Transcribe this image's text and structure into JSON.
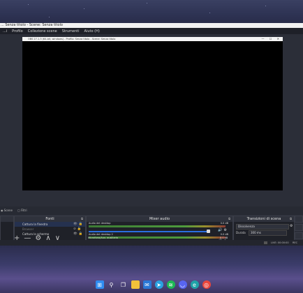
{
  "window": {
    "title": "... Senza titolo - Scene: Senza titolo",
    "menu": [
      "...i",
      "Profilo",
      "Collezione scene",
      "Strumenti",
      "Aiuto (H)"
    ]
  },
  "projector": {
    "title": "OBS 27.1.3 (64-bit, windows) - Profilo: Senza titolo - Scene: Senza titolo",
    "controls": "— ☐ ✕"
  },
  "dock_tabs": [
    "Scene",
    "Filtri"
  ],
  "sources": {
    "header": "Fonti",
    "items": [
      {
        "label": "Cattura la finestra",
        "enabled": true
      },
      {
        "label": "Browser",
        "enabled": false
      },
      {
        "label": "Cattura lo schermo",
        "enabled": true
      }
    ],
    "toolbar": [
      "+",
      "—",
      "⚙",
      "∧",
      "∨"
    ]
  },
  "mixer": {
    "header": "Mixer audio",
    "tracks": [
      {
        "name": "Audio del desktop",
        "db": "0.0 dB"
      },
      {
        "name": "Audio del desktop 2",
        "db": "0.0 dB"
      },
      {
        "name": "Microfono/Aux. ausiliario",
        "db": "0.0 dB"
      }
    ],
    "ticks": [
      "-60",
      "-55",
      "-50",
      "-45",
      "-40",
      "-35",
      "-30",
      "-25",
      "-20",
      "-15",
      "-10",
      "-5",
      "0"
    ]
  },
  "transitions": {
    "header": "Transizioni di scena",
    "selected": "Dissolvenza",
    "duration_label": "Durata",
    "duration_value": "300 ms"
  },
  "status": {
    "live": "LIVE: 00:00:00",
    "rec": "REC"
  },
  "taskbar": {
    "icons": [
      "windows-icon",
      "search-icon",
      "task-view-icon",
      "file-explorer-icon",
      "mail-icon",
      "telegram-icon",
      "spotify-icon",
      "discord-icon",
      "edge-icon",
      "chrome-icon"
    ],
    "colors": {
      "windows": "#2f8cf0",
      "explorer": "#f2c23a",
      "mail": "#2a78d6",
      "telegram": "#2aa1e0",
      "spotify": "#1db954",
      "discord": "#5865f2",
      "edge": "#1fa3a8",
      "chrome": "#e8453c"
    }
  }
}
